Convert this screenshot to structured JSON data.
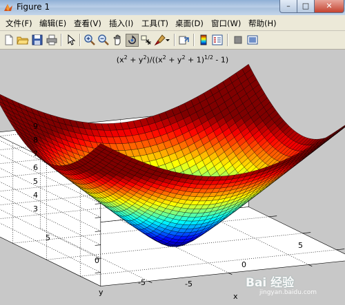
{
  "window": {
    "title": "Figure 1",
    "buttons": {
      "minimize": "–",
      "maximize": "□",
      "close": "✕"
    }
  },
  "menubar": {
    "items": [
      {
        "label": "文件(F)"
      },
      {
        "label": "编辑(E)"
      },
      {
        "label": "查看(V)"
      },
      {
        "label": "插入(I)"
      },
      {
        "label": "工具(T)"
      },
      {
        "label": "桌面(D)"
      },
      {
        "label": "窗口(W)"
      },
      {
        "label": "帮助(H)"
      }
    ]
  },
  "toolbar": {
    "icons": [
      "new-figure-icon",
      "open-file-icon",
      "save-icon",
      "print-icon",
      "edit-plot-icon",
      "zoom-in-icon",
      "zoom-out-icon",
      "pan-icon",
      "rotate-3d-icon",
      "data-cursor-icon",
      "brush-icon",
      "link-plot-icon",
      "insert-colorbar-icon",
      "insert-legend-icon",
      "hide-plot-tools-icon",
      "show-plot-tools-icon"
    ]
  },
  "chart_data": {
    "type": "surface",
    "function": "(x^2 + y^2)/((x^2 + y^2 + 1)^(1/2) - 1)",
    "title_main": "(x",
    "title_parts": [
      "(x",
      "2",
      " + y",
      "2",
      ")/((x",
      "2",
      " + y",
      "2",
      " + 1)",
      "1/2",
      " - 1)"
    ],
    "x": {
      "label": "x",
      "ticks": [
        "-5",
        "0",
        "5"
      ],
      "range": [
        -8,
        8
      ]
    },
    "y": {
      "label": "y",
      "ticks": [
        "5",
        "0",
        "-5"
      ],
      "range": [
        -8,
        8
      ]
    },
    "z": {
      "ticks": [
        "9",
        "8",
        "7",
        "6",
        "5",
        "4",
        "3"
      ],
      "range": [
        2,
        9.3
      ]
    },
    "colormap": "jet",
    "grid": true
  },
  "watermark": {
    "text": "Bai 经验",
    "sub": "jingyan.baidu.com"
  }
}
